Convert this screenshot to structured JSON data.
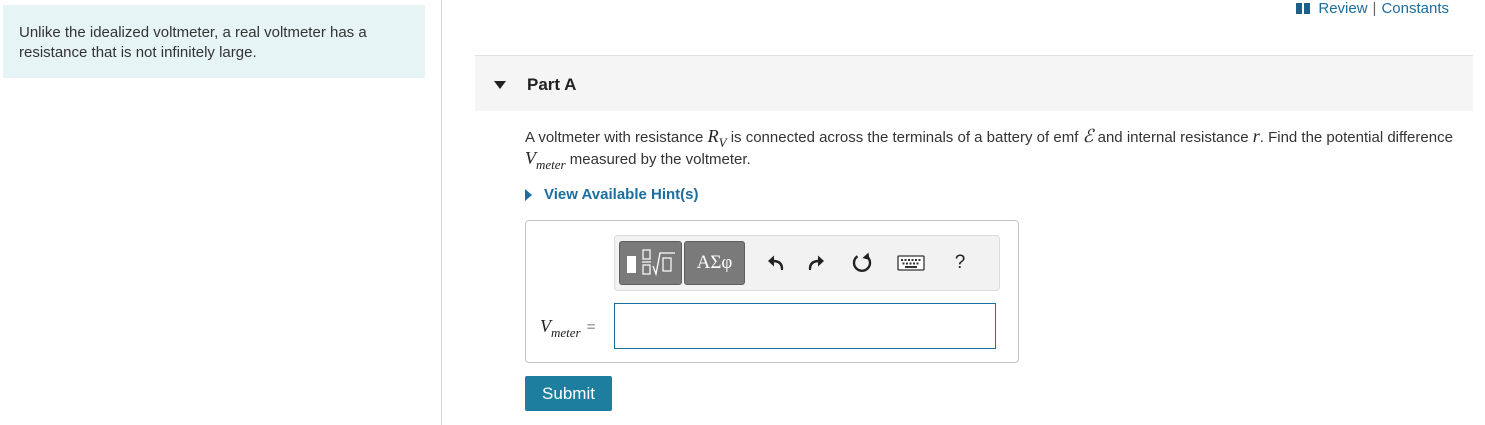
{
  "intro": {
    "text": "Unlike the idealized voltmeter, a real voltmeter has a resistance that is not infinitely large."
  },
  "toplinks": {
    "review": "Review",
    "separator": "|",
    "constants": "Constants"
  },
  "part": {
    "title": "Part A"
  },
  "question": {
    "text_1": "A voltmeter with resistance ",
    "var_r_main": "R",
    "var_r_sub": "V",
    "text_2": " is connected across the terminals of a battery of emf ",
    "var_emf": "ℰ",
    "text_3": " and internal resistance ",
    "var_r": "r",
    "text_4": ". Find the potential difference ",
    "var_v_main": "V",
    "var_v_sub": "meter",
    "text_5": " measured by the voltmeter."
  },
  "hint": {
    "label": "View Available Hint(s)"
  },
  "toolbar": {
    "greek_label": "ΑΣφ",
    "help_label": "?"
  },
  "answer": {
    "var_main": "V",
    "var_sub": "meter",
    "equals": "=",
    "value": ""
  },
  "submit": {
    "label": "Submit"
  },
  "colors": {
    "accent": "#1a6ea0",
    "submit_bg": "#1e7ea0",
    "intro_bg": "#e6f4f6",
    "toolbar_button": "#7a7a7a"
  },
  "icons": [
    "book-icon",
    "caret-down-icon",
    "caret-right-icon",
    "templates-icon",
    "undo-icon",
    "redo-icon",
    "reset-icon",
    "keyboard-icon",
    "help-icon"
  ]
}
